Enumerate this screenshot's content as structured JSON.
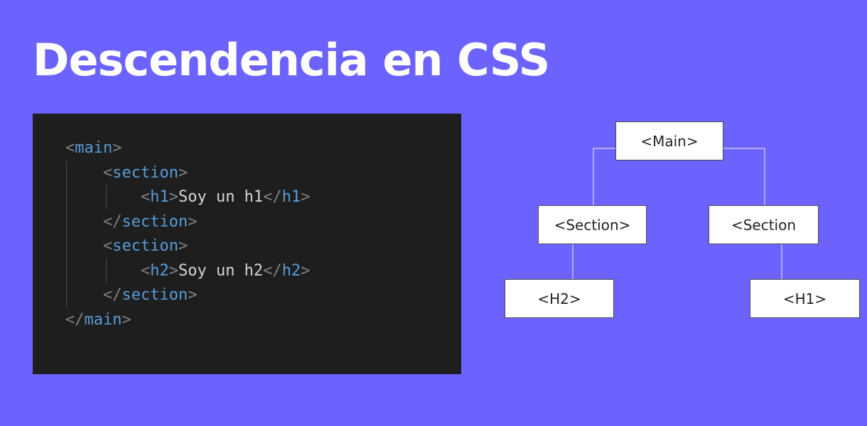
{
  "slide": {
    "title": "Descendencia en CSS",
    "background_color": "#6c63ff"
  },
  "code": {
    "lines": [
      {
        "indent": "",
        "open": "<",
        "tag": "main",
        "close": ">",
        "text": ""
      },
      {
        "indent": "    ",
        "open": "<",
        "tag": "section",
        "close": ">",
        "text": ""
      },
      {
        "indent": "        ",
        "open": "<",
        "tag": "h1",
        "close": ">",
        "text": "Soy un h1",
        "end_open": "</",
        "end_tag": "h1",
        "end_close": ">"
      },
      {
        "indent": "    ",
        "open": "</",
        "tag": "section",
        "close": ">",
        "text": ""
      },
      {
        "indent": "    ",
        "open": "<",
        "tag": "section",
        "close": ">",
        "text": ""
      },
      {
        "indent": "        ",
        "open": "<",
        "tag": "h2",
        "close": ">",
        "text": "Soy un h2",
        "end_open": "</",
        "end_tag": "h2",
        "end_close": ">"
      },
      {
        "indent": "    ",
        "open": "</",
        "tag": "section",
        "close": ">",
        "text": ""
      },
      {
        "indent": "",
        "open": "</",
        "tag": "main",
        "close": ">",
        "text": ""
      }
    ],
    "colors": {
      "background": "#1e1e1e",
      "tag": "#569cd6",
      "bracket": "#808080",
      "text": "#d4d4d4"
    }
  },
  "tree": {
    "main": "<Main>",
    "section_left": "<Section>",
    "section_right": "<Section",
    "h2": "<H2>",
    "h1": "<H1>"
  }
}
